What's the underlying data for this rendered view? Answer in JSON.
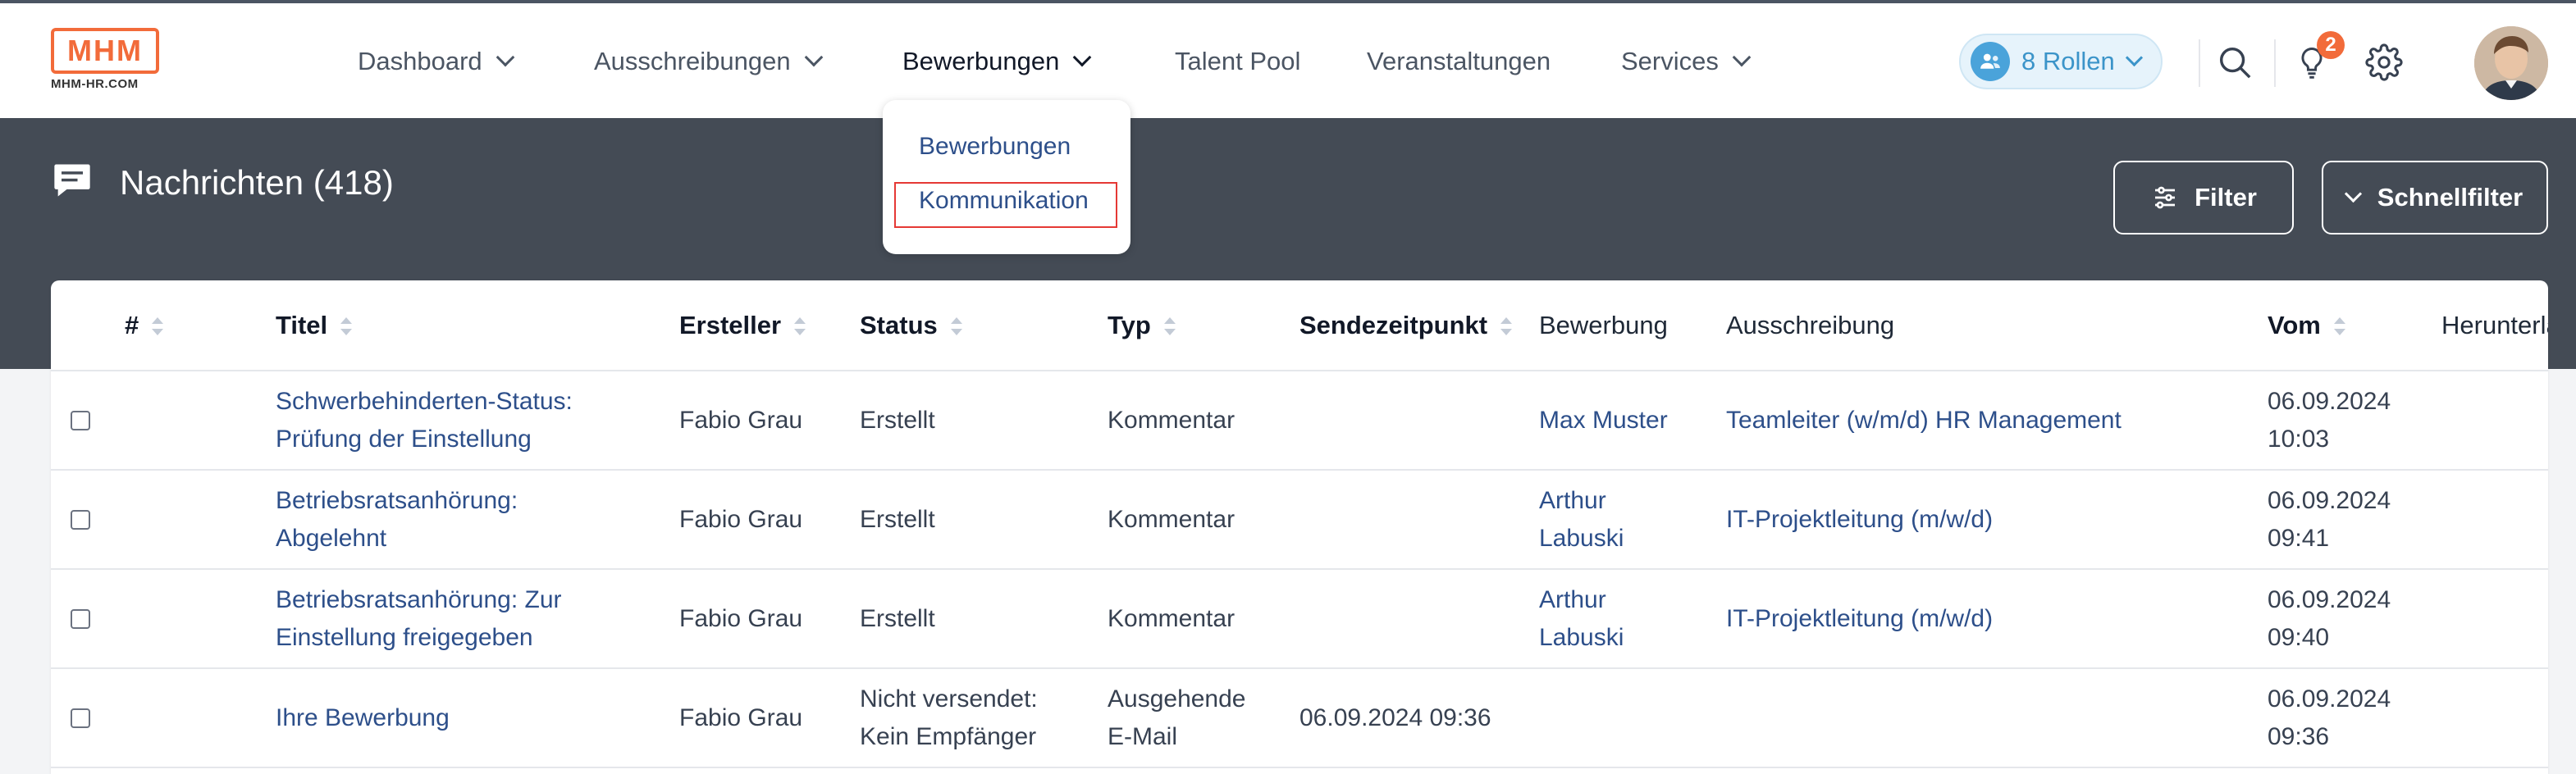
{
  "logo": {
    "main": "MHM",
    "sub": "MHM-HR.COM",
    "color": "#f26b3a"
  },
  "nav": {
    "dashboard": "Dashboard",
    "ausschreibungen": "Ausschreibungen",
    "bewerbungen": "Bewerbungen",
    "talent_pool": "Talent Pool",
    "veranstaltungen": "Veranstaltungen",
    "services": "Services"
  },
  "roles": {
    "label": "8 Rollen",
    "icon": "user-group-icon"
  },
  "notifications": {
    "count": "2",
    "icon": "lightbulb-icon"
  },
  "icons": {
    "search": "search-icon",
    "settings": "gear-icon",
    "avatar": "user-avatar"
  },
  "dropdown": {
    "items": [
      "Bewerbungen",
      "Kommunikation"
    ],
    "highlighted": "Kommunikation"
  },
  "header": {
    "title": "Nachrichten (418)",
    "filter_label": "Filter",
    "quickfilter_label": "Schnellfilter"
  },
  "table": {
    "columns": [
      "#",
      "Titel",
      "Ersteller",
      "Status",
      "Typ",
      "Sendezeitpunkt",
      "Bewerbung",
      "Ausschreibung",
      "Vom",
      "Herunterladen"
    ],
    "rows": [
      {
        "titel": "Schwerbehinderten-Status: Prüfung der Einstellung",
        "ersteller": "Fabio Grau",
        "status": "Erstellt",
        "typ": "Kommentar",
        "sendezeitpunkt": "",
        "bewerbung": "Max Muster",
        "ausschreibung": "Teamleiter (w/m/d) HR Management",
        "vom_date": "06.09.2024",
        "vom_time": "10:03"
      },
      {
        "titel": "Betriebsratsanhörung: Abgelehnt",
        "ersteller": "Fabio Grau",
        "status": "Erstellt",
        "typ": "Kommentar",
        "sendezeitpunkt": "",
        "bewerbung": "Arthur Labuski",
        "ausschreibung": "IT-Projektleitung (m/w/d)",
        "vom_date": "06.09.2024",
        "vom_time": "09:41"
      },
      {
        "titel": "Betriebsratsanhörung: Zur Einstellung freigegeben",
        "ersteller": "Fabio Grau",
        "status": "Erstellt",
        "typ": "Kommentar",
        "sendezeitpunkt": "",
        "bewerbung": "Arthur Labuski",
        "ausschreibung": "IT-Projektleitung (m/w/d)",
        "vom_date": "06.09.2024",
        "vom_time": "09:40"
      },
      {
        "titel": "Ihre Bewerbung",
        "ersteller": "Fabio Grau",
        "status": "Nicht versendet: Kein Empfänger",
        "typ": "Ausgehende E-Mail",
        "sendezeitpunkt": "06.09.2024 09:36",
        "bewerbung": "",
        "ausschreibung": "",
        "vom_date": "06.09.2024",
        "vom_time": "09:36"
      }
    ]
  }
}
